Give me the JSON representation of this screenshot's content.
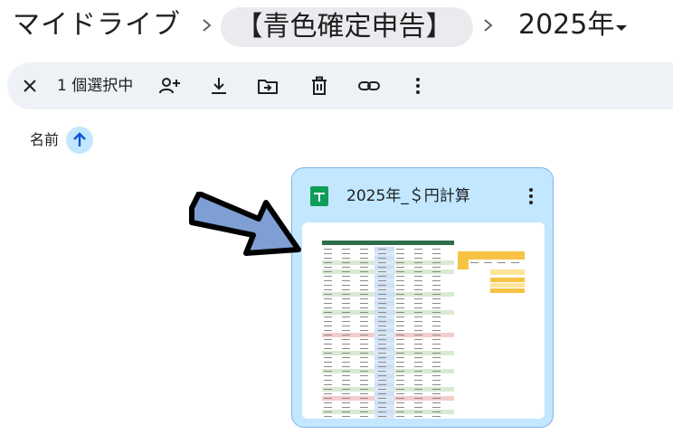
{
  "breadcrumb": {
    "root": "マイドライブ",
    "folder": "【青色確定申告】",
    "current": "2025年"
  },
  "toolbar": {
    "selected_count": "1 個選択中",
    "icons": [
      "close-icon",
      "share-icon",
      "download-icon",
      "move-to-folder-icon",
      "trash-icon",
      "link-icon",
      "more-vert-icon"
    ]
  },
  "sort": {
    "label": "名前",
    "direction": "ascending"
  },
  "file": {
    "title": "2025年_＄円計算",
    "type_icon": "google-sheets-icon"
  },
  "colors": {
    "selected_card": "#c2e7ff",
    "toolbar_bg": "#eef1f6",
    "folder_chip_bg": "#e9ebee",
    "sheets_green": "#0f9d58",
    "annotation_arrow": "#7f9fd4"
  }
}
